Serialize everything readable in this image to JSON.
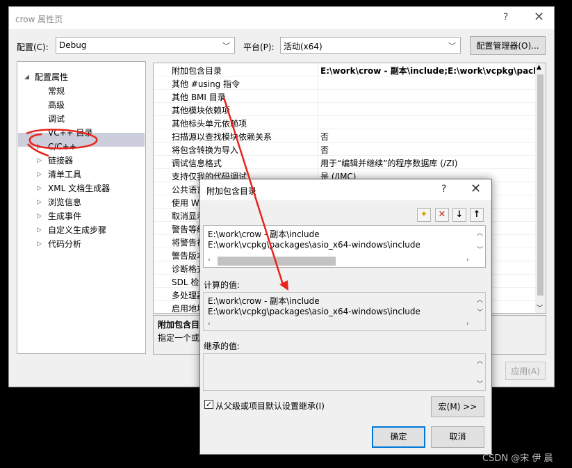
{
  "main_window": {
    "title": "crow 属性页",
    "help_glyph": "?",
    "close_glyph": "✕",
    "config_label": "配置(C):",
    "config_value": "Debug",
    "platform_label": "平台(P):",
    "platform_value": "活动(x64)",
    "config_manager_button": "配置管理器(O)...",
    "apply_button": "应用(A)",
    "tree": [
      {
        "label": "配置属性",
        "expander": "◢"
      },
      {
        "label": "常规"
      },
      {
        "label": "高级"
      },
      {
        "label": "调试"
      },
      {
        "label": "VC++ 目录"
      },
      {
        "label": "C/C++",
        "expander": "▷",
        "selected": true
      },
      {
        "label": "链接器",
        "expander": "▷"
      },
      {
        "label": "清单工具",
        "expander": "▷"
      },
      {
        "label": "XML 文档生成器",
        "expander": "▷"
      },
      {
        "label": "浏览信息",
        "expander": "▷"
      },
      {
        "label": "生成事件",
        "expander": "▷"
      },
      {
        "label": "自定义生成步骤",
        "expander": "▷"
      },
      {
        "label": "代码分析",
        "expander": "▷"
      }
    ],
    "grid": [
      {
        "name": "附加包含目录",
        "value": "E:\\work\\crow - 副本\\include;E:\\work\\vcpkg\\packag"
      },
      {
        "name": "其他 #using 指令",
        "value": ""
      },
      {
        "name": "其他 BMI 目录",
        "value": ""
      },
      {
        "name": "其他模块依赖项",
        "value": ""
      },
      {
        "name": "其他标头单元依赖项",
        "value": ""
      },
      {
        "name": "扫描源以查找模块依赖关系",
        "value": "否"
      },
      {
        "name": "将包含转换为导入",
        "value": "否"
      },
      {
        "name": "调试信息格式",
        "value": "用于“编辑并继续”的程序数据库 (/ZI)"
      },
      {
        "name": "支持仅我的代码调试",
        "value": "是 (/JMC)"
      },
      {
        "name": "公共语言",
        "value": ""
      },
      {
        "name": "使用 Wi",
        "value": ""
      },
      {
        "name": "取消显示",
        "value": ""
      },
      {
        "name": "警告等级",
        "value": ""
      },
      {
        "name": "将警告视",
        "value": ""
      },
      {
        "name": "警告版本",
        "value": ""
      },
      {
        "name": "诊断格式",
        "value": ""
      },
      {
        "name": "SDL 检查",
        "value": ""
      },
      {
        "name": "多处理器",
        "value": ""
      },
      {
        "name": "启用地址",
        "value": ""
      }
    ],
    "desc_title": "附加包含目",
    "desc_text": "指定一个或"
  },
  "dialog": {
    "title": "附加包含目录",
    "help_glyph": "?",
    "close_glyph": "✕",
    "tools": {
      "new_line": "✦",
      "delete": "✕",
      "move_down": "↓",
      "move_up": "↑"
    },
    "entries": [
      "E:\\work\\crow - 副本\\include",
      "E:\\work\\vcpkg\\packages\\asio_x64-windows\\include"
    ],
    "computed_label": "计算的值:",
    "computed": [
      "E:\\work\\crow - 副本\\include",
      "E:\\work\\vcpkg\\packages\\asio_x64-windows\\include"
    ],
    "inherited_label": "继承的值:",
    "inherit_checkbox_label": "从父级或项目默认设置继承(I)",
    "inherit_checked": true,
    "macro_button": "宏(M) >>",
    "ok_button": "确定",
    "cancel_button": "取消"
  },
  "watermark": "CSDN @宋 伊 晨",
  "colors": {
    "annotation_red": "#e8231b",
    "selection_bg": "#cccedb",
    "dialog_focus": "#0078d7"
  }
}
